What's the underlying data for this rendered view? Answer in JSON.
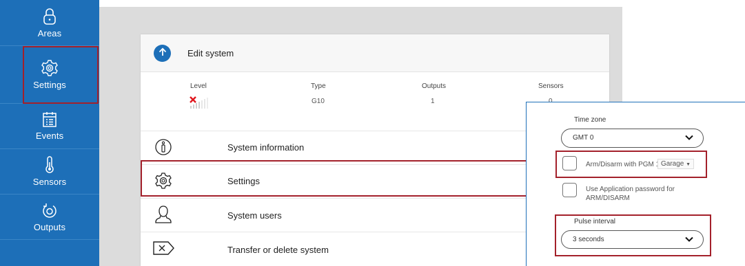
{
  "sidebar": {
    "items": [
      {
        "label": "Areas",
        "icon": "lock-icon"
      },
      {
        "label": "Settings",
        "icon": "gear-icon"
      },
      {
        "label": "Events",
        "icon": "calendar-list-icon"
      },
      {
        "label": "Sensors",
        "icon": "thermometer-icon"
      },
      {
        "label": "Outputs",
        "icon": "power-icon"
      }
    ]
  },
  "header": {
    "title": "Edit system"
  },
  "system_info": {
    "columns": [
      "Level",
      "Type",
      "Outputs",
      "Sensors"
    ],
    "values": {
      "type": "G10",
      "outputs": "1",
      "sensors": "0"
    }
  },
  "menu": {
    "items": [
      {
        "label": "System information",
        "icon": "info-icon"
      },
      {
        "label": "Settings",
        "icon": "gear-icon"
      },
      {
        "label": "System users",
        "icon": "user-icon"
      },
      {
        "label": "Transfer or delete system",
        "icon": "delete-tag-icon"
      }
    ]
  },
  "settings_popup": {
    "time_zone_label": "Time zone",
    "time_zone_value": "GMT 0",
    "arm_disarm_label": "Arm/Disarm with PGM 1",
    "arm_disarm_select": "Garage",
    "app_password_label_line1": "Use Application password for",
    "app_password_label_line2": "ARM/DISARM",
    "pulse_interval_label": "Pulse interval",
    "pulse_interval_value": "3 seconds"
  },
  "colors": {
    "brand": "#1d6fb8",
    "highlight": "#a3202a",
    "error": "#e0161d"
  }
}
